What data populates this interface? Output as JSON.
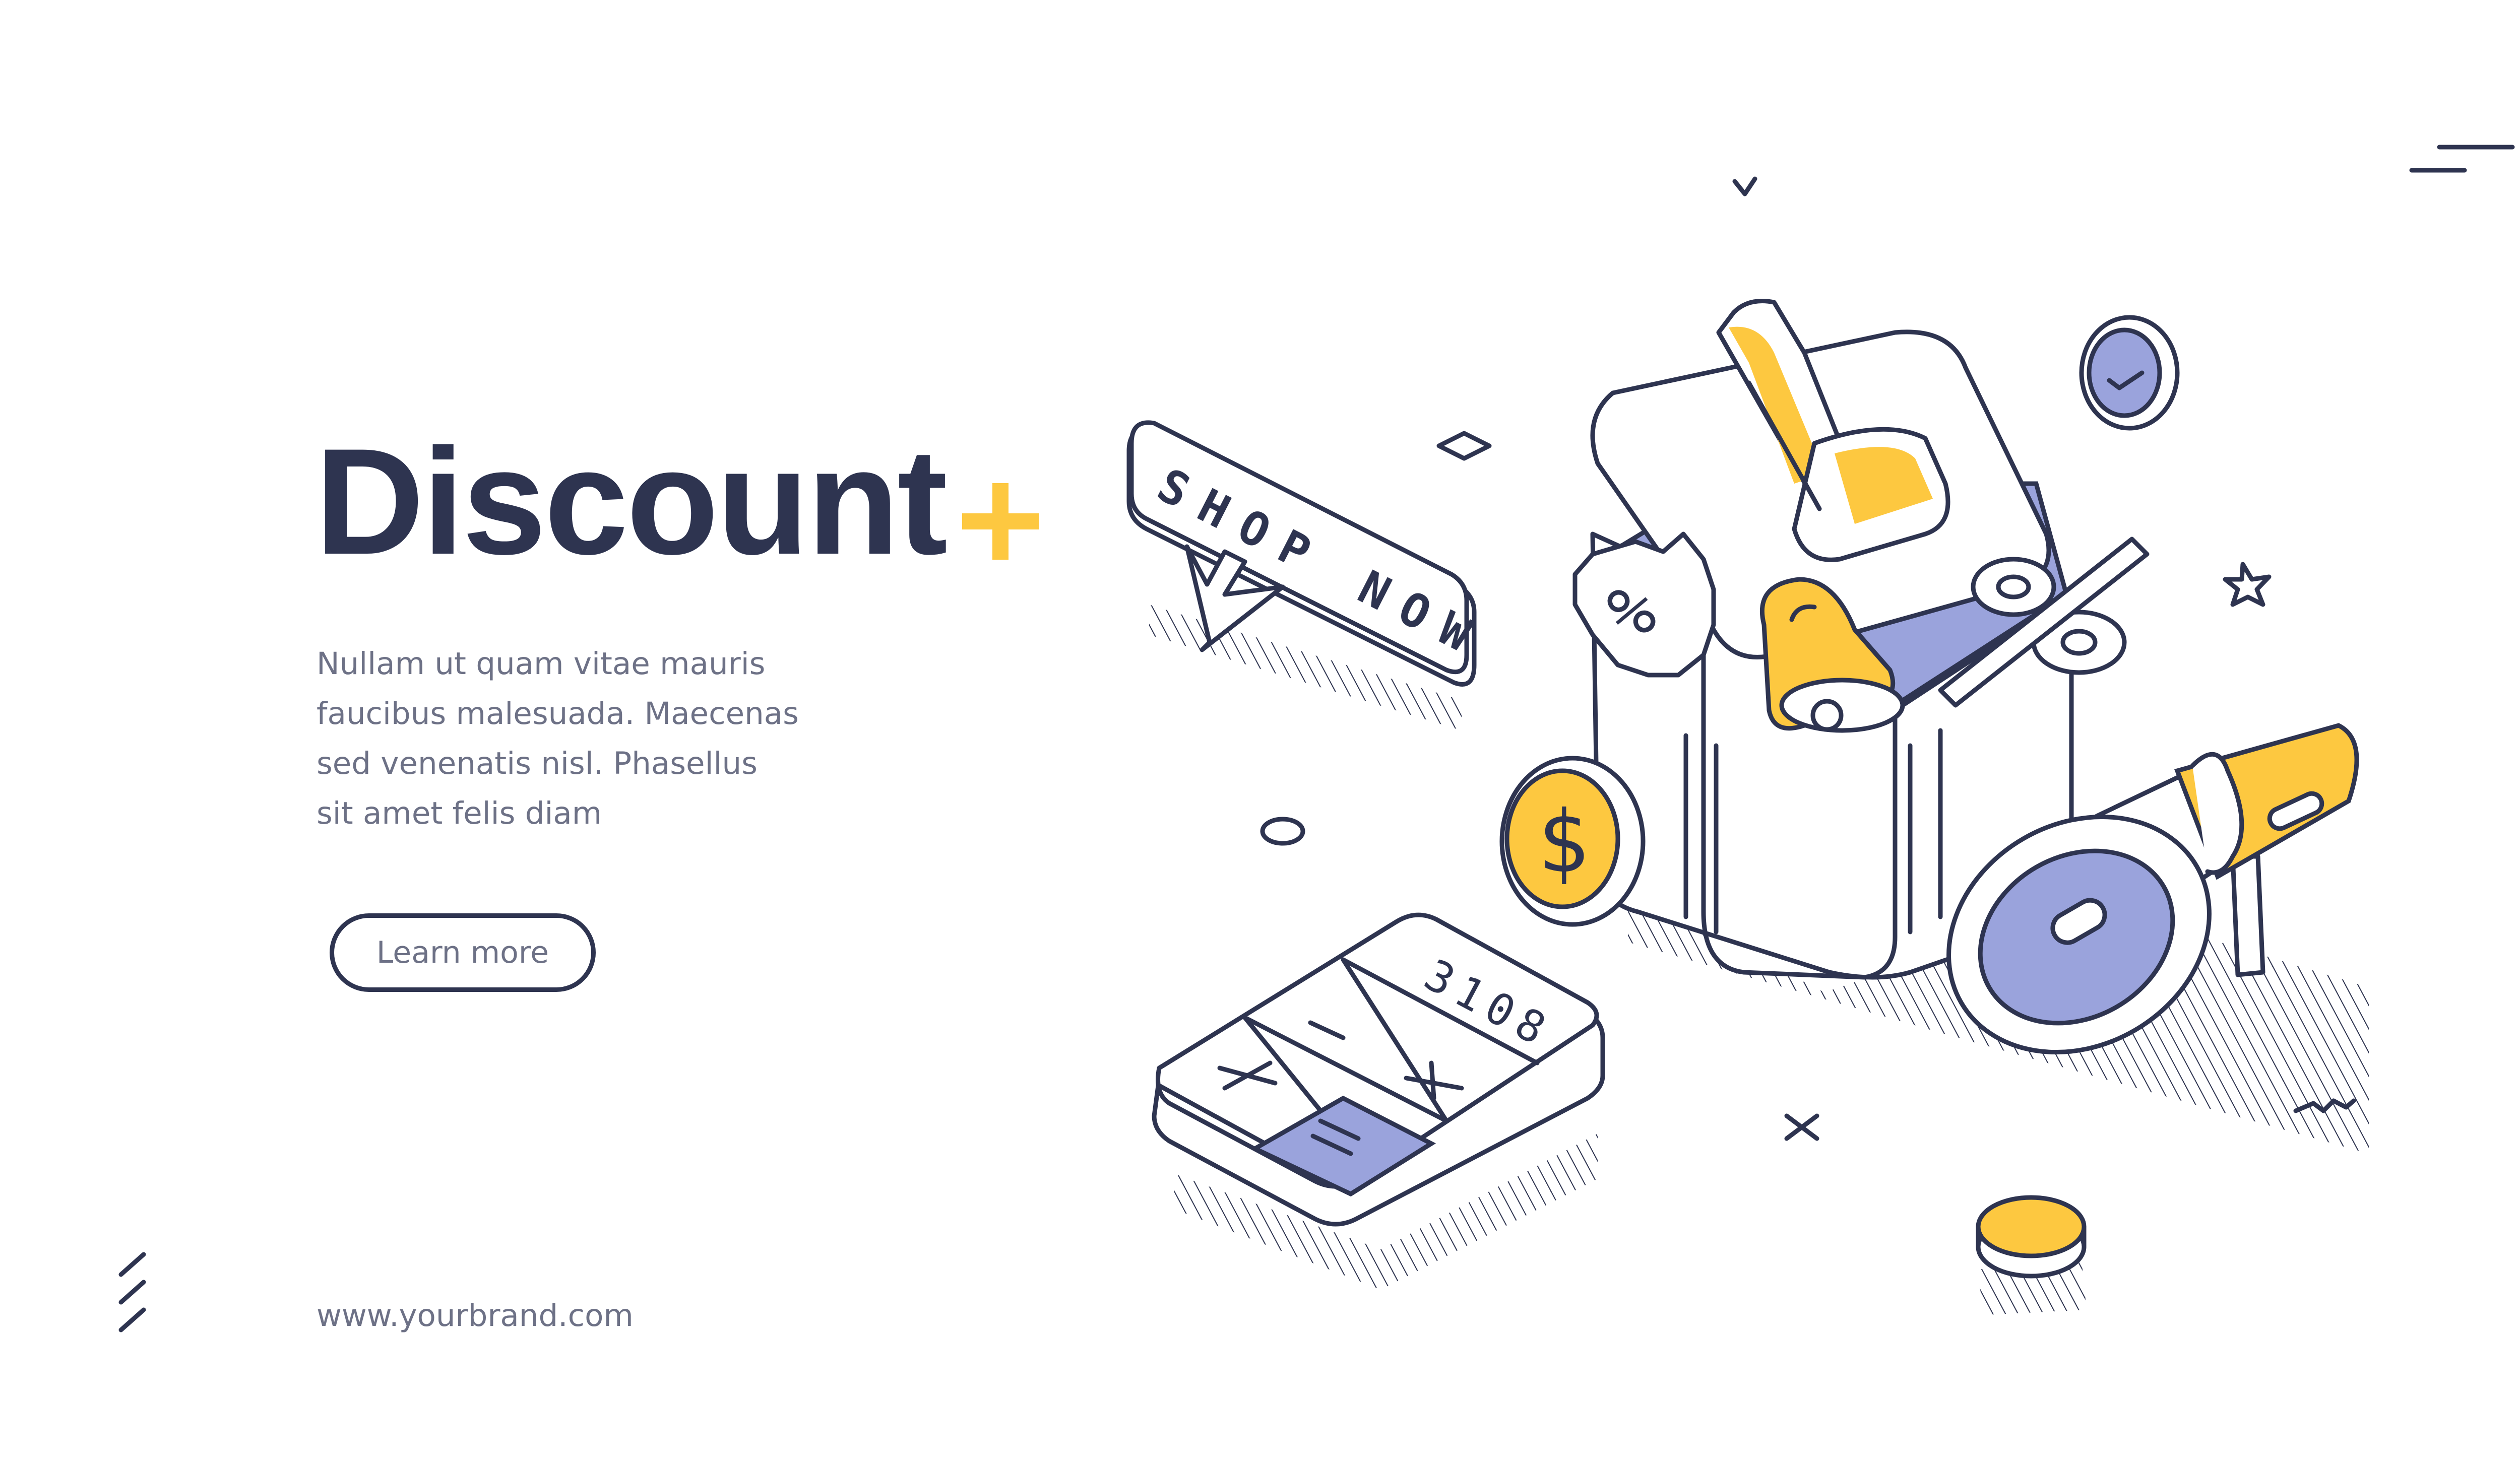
{
  "hero": {
    "title": "Discount",
    "body": "Nullam ut quam vitae mauris\nfaucibus malesuada. Maecenas\nsed venenatis nisl. Phasellus\nsit amet felis diam",
    "cta_label": "Learn more",
    "website": "www.yourbrand.com"
  },
  "illustration": {
    "shop_sign_text": "SHOP NOW",
    "calculator_display": "3108",
    "calculator_keys": [
      "—",
      "×",
      "+",
      "="
    ],
    "coupon_symbol": "%",
    "coin_symbol": "$",
    "icons": [
      "plus-icon",
      "gift-box-icon",
      "bell-icon",
      "megaphone-icon",
      "coin-icon",
      "calculator-icon",
      "cursor-icon",
      "clock-icon",
      "coupon-icon"
    ]
  },
  "colors": {
    "ink": "#2e3450",
    "text_muted": "#6d7186",
    "accent_yellow": "#fdc840",
    "accent_lavender": "#9aa3dc",
    "background": "#ffffff"
  }
}
